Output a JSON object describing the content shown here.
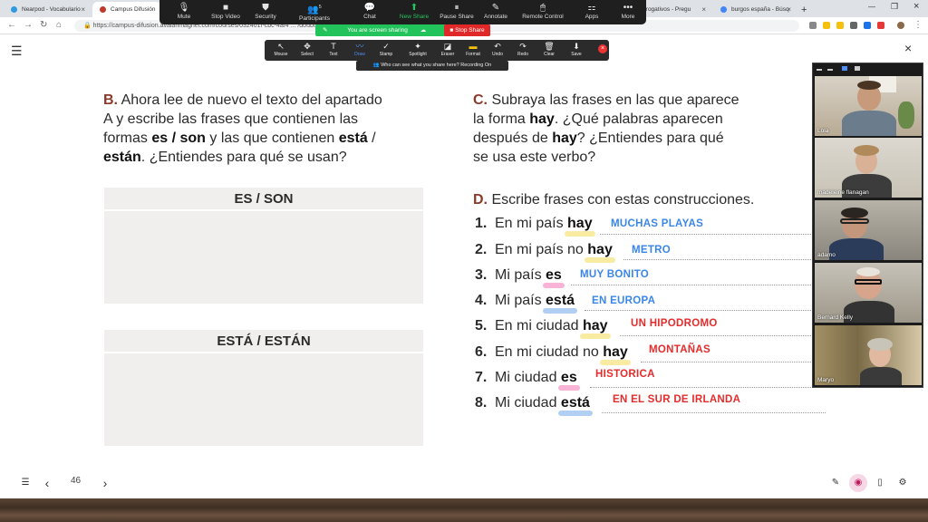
{
  "browser": {
    "tabs": [
      {
        "title": "Nearpod - Vocabulario",
        "color": "#2e9be0"
      },
      {
        "title": "Campus Difusión",
        "color": "#c0392b"
      },
      {
        "title": "errogativos - Pregu",
        "color": "#4285f4"
      },
      {
        "title": "burgos españa - Búsq",
        "color": "#4285f4"
      }
    ],
    "new_tab": "+",
    "url": "https://campus-difusion.avalanmagnet.com/courses/032401f-cbc-4af4 ... /doubts/review"
  },
  "zoom_toolbar": {
    "items": [
      {
        "label": "Mute",
        "icon": "🎙"
      },
      {
        "label": "Stop Video",
        "icon": "■"
      },
      {
        "label": "Security",
        "icon": "⛊"
      },
      {
        "label": "Participants",
        "icon": "👥",
        "badge": "5"
      },
      {
        "label": "Chat",
        "icon": "💬"
      },
      {
        "label": "New Share",
        "icon": "⬆"
      },
      {
        "label": "Pause Share",
        "icon": "⏸"
      },
      {
        "label": "Annotate",
        "icon": "✎"
      },
      {
        "label": "Remote Control",
        "icon": "🖱"
      },
      {
        "label": "Apps",
        "icon": "⚏"
      },
      {
        "label": "More",
        "icon": "•••"
      }
    ],
    "sharing_status": "You are screen sharing",
    "stop_share": "Stop Share"
  },
  "annotate_toolbar": {
    "tools": [
      "Mouse",
      "Select",
      "Text",
      "Draw",
      "Stamp",
      "Spotlight",
      "Eraser",
      "Format",
      "Undo",
      "Redo",
      "Clear",
      "Save"
    ],
    "tool_icons": [
      "↖",
      "✥",
      "T",
      "〰",
      "✓",
      "✦",
      "◪",
      "▬",
      "↶",
      "↷",
      "🗑",
      "⬇"
    ],
    "active_tool": "Draw",
    "recording_note": "Who can see what you share here? Recording On"
  },
  "exercise": {
    "b_letter": "B.",
    "b_text_1": "Ahora lee de nuevo el texto del apartado",
    "b_text_2": "A y escribe las frases que contienen las",
    "b_text_3a": "formas ",
    "b_text_3b": "es / son",
    "b_text_3c": " y las que contienen ",
    "b_text_3d": "está",
    "b_text_3e": " /",
    "b_text_4a": "están",
    "b_text_4b": ". ¿Entiendes para qué se usan?",
    "c_letter": "C.",
    "c_text_1": "Subraya las frases en las que aparece",
    "c_text_2a": "la forma ",
    "c_text_2b": "hay",
    "c_text_2c": ". ¿Qué palabras aparecen",
    "c_text_3a": "después de ",
    "c_text_3b": "hay",
    "c_text_3c": "? ¿Entiendes para qué",
    "c_text_4": "se usa este verbo?",
    "box1_header": "ES / SON",
    "box2_header": "ESTÁ / ESTÁN",
    "d_letter": "D.",
    "d_text": "Escribe frases con estas construcciones.",
    "items": [
      {
        "num": "1.",
        "pre": "En mi país ",
        "kw": "hay",
        "answer": "MUCHAS PLAYAS",
        "hl": "#f7e27a",
        "ac": "#3a86e8"
      },
      {
        "num": "2.",
        "pre": "En mi país no ",
        "kw": "hay",
        "answer": "METRO",
        "hl": "#f7e27a",
        "ac": "#3a86e8"
      },
      {
        "num": "3.",
        "pre": "Mi país ",
        "kw": "es",
        "answer": "MUY BONITO",
        "hl": "#f59ac8",
        "ac": "#3a86e8"
      },
      {
        "num": "4.",
        "pre": "Mi país ",
        "kw": "está",
        "answer": "EN EUROPA",
        "hl": "#9ec3f0",
        "ac": "#3a86e8"
      },
      {
        "num": "5.",
        "pre": "En mi ciudad ",
        "kw": "hay",
        "answer": "UN HIPODROMO",
        "hl": "#f7e27a",
        "ac": "#e52b2b"
      },
      {
        "num": "6.",
        "pre": "En mi ciudad no ",
        "kw": "hay",
        "answer": "MONTAÑAS",
        "hl": "#f7e27a",
        "ac": "#e52b2b"
      },
      {
        "num": "7.",
        "pre": "Mi ciudad ",
        "kw": "es",
        "answer": "HISTORICA",
        "hl": "#f59ac8",
        "ac": "#e52b2b"
      },
      {
        "num": "8.",
        "pre": "Mi ciudad ",
        "kw": "está",
        "answer": "EN EL SUR DE IRLANDA",
        "hl": "#9ec3f0",
        "ac": "#e52b2b"
      }
    ]
  },
  "participants": [
    {
      "name": "Lola"
    },
    {
      "name": "madeleine flanagan"
    },
    {
      "name": "adamo"
    },
    {
      "name": "Bernard Kelly"
    },
    {
      "name": "Maryo"
    }
  ],
  "bottom": {
    "page_number": "46",
    "prev": "‹",
    "next": "›"
  }
}
